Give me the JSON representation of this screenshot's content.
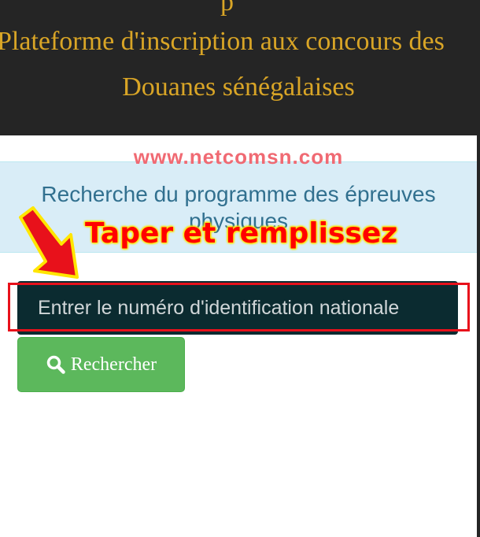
{
  "header": {
    "fragment": "p",
    "line1": "Plateforme d'inscription aux concours des",
    "line2": "Douanes sénégalaises"
  },
  "watermark": "www.netcomsn.com",
  "panel": {
    "title": "Recherche du programme des épreuves physiques"
  },
  "annotation": {
    "text": "Taper et remplissez",
    "color": "#ff0000",
    "highlight": "#ffe600"
  },
  "search": {
    "placeholder": "Entrer le numéro d'identification nationale",
    "value": ""
  },
  "button": {
    "icon": "search-icon",
    "label": "Rechercher"
  },
  "colors": {
    "header_bg": "#252525",
    "header_text": "#d9a526",
    "panel_bg": "#d9edf7",
    "panel_text": "#31708f",
    "input_bg": "#0b2b30",
    "button_bg": "#5cb85c",
    "highlight_border": "#e8111b"
  }
}
